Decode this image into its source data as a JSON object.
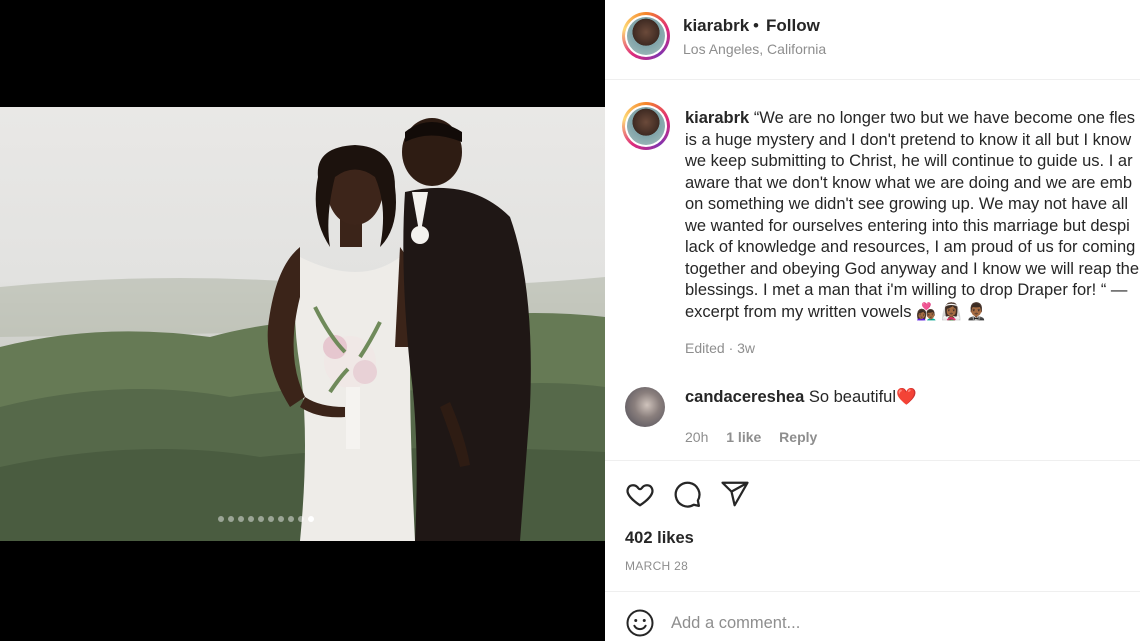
{
  "post": {
    "username": "kiarabrk",
    "separator": "•",
    "follow_label": "Follow",
    "location": "Los Angeles, California",
    "caption_lines": [
      "“We are no longer two but we have become one fles",
      "is a huge mystery and I don't pretend to know it all but I know",
      "we keep submitting to Christ, he will continue to guide us. I ar",
      "aware that we don't know what we are doing and we are emb",
      "on something we didn't see growing up. We may not have all",
      "we wanted for ourselves entering into this marriage but despi",
      "lack of knowledge and resources, I am proud of us for coming",
      "together and obeying God anyway and I know we will reap the",
      "blessings. I met a man that i'm willing to drop Draper for! “ —",
      "excerpt from my written vowels 👩🏾‍❤️‍👨🏾 👰🏾‍♀️ 🤵🏾‍♂️"
    ],
    "caption_meta": "Edited · 3w",
    "comment": {
      "username": "candacereshea",
      "text": "So beautiful",
      "emoji": "❤️",
      "time": "20h",
      "likes": "1 like",
      "reply_label": "Reply"
    },
    "likes": "402 likes",
    "date": "MARCH 28",
    "add_comment_placeholder": "Add a comment...",
    "carousel": {
      "count": 10,
      "active_index": 9
    }
  },
  "icons": [
    "heart-icon",
    "comment-icon",
    "share-icon",
    "emoji-icon"
  ],
  "colors": {
    "text": "#262626",
    "muted": "#8e8e8e",
    "heart": "#ed4956"
  }
}
